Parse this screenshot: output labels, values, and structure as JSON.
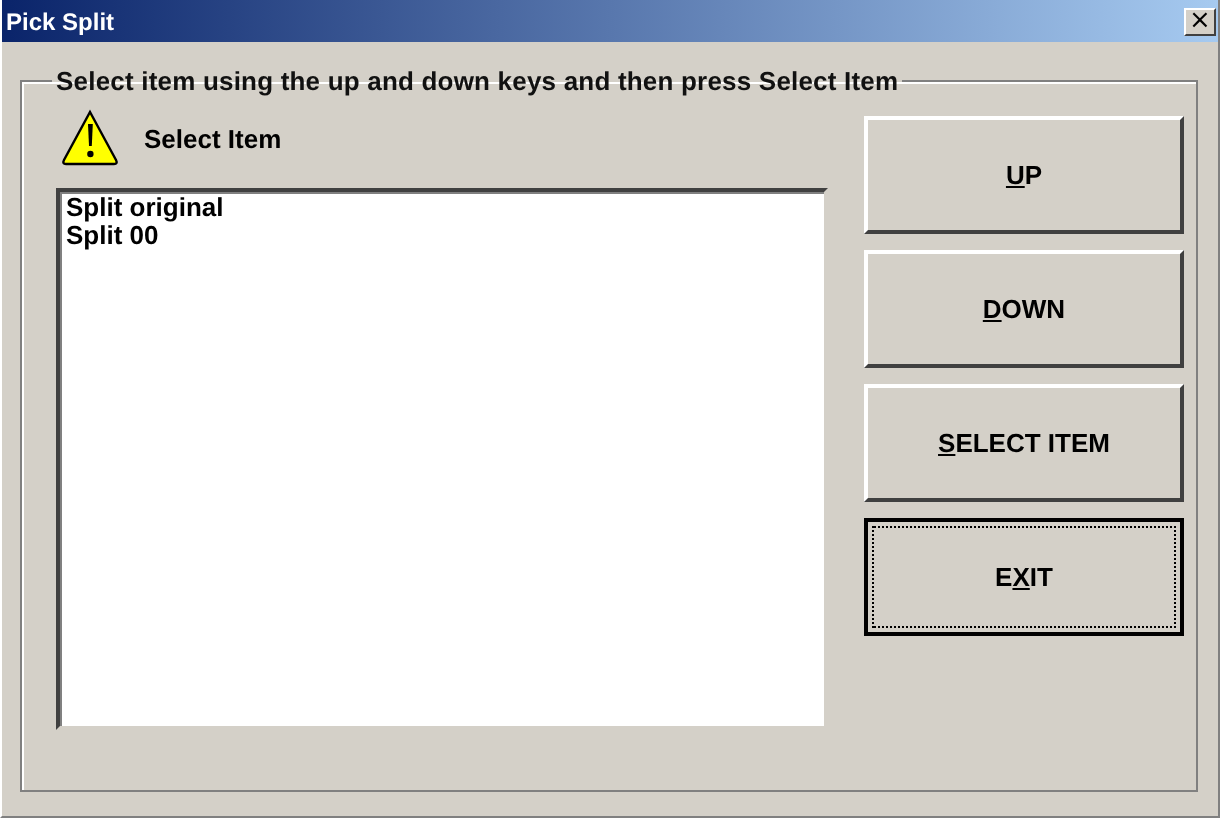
{
  "window": {
    "title": "Pick Split",
    "close": "×"
  },
  "group": {
    "caption": "Select item using the up and down keys and then press Select Item"
  },
  "prompt": {
    "label": "Select Item"
  },
  "list": {
    "items": [
      {
        "text": "Split original",
        "selected": false
      },
      {
        "text": "Split 00",
        "selected": false
      }
    ]
  },
  "buttons": [
    {
      "key": "U",
      "after": "P",
      "focused": false
    },
    {
      "key": "D",
      "after": "OWN",
      "focused": false
    },
    {
      "key": "S",
      "after": "ELECT ITEM",
      "focused": false
    },
    {
      "before": "E",
      "key": "X",
      "after": "IT",
      "focused": true
    }
  ]
}
